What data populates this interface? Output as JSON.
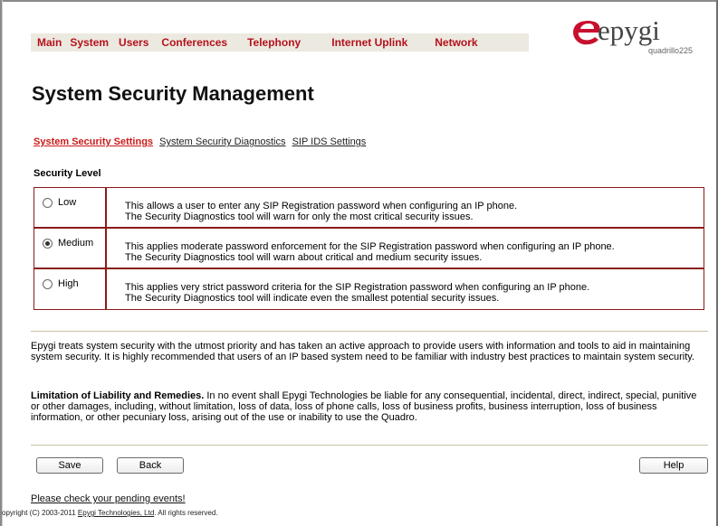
{
  "menu": [
    "Main",
    "System",
    "Users",
    "Conferences",
    "Telephony",
    "Internet Uplink",
    "Network"
  ],
  "logo": {
    "word": "epygi",
    "model": "quadrillo225",
    "color": "#c8102e"
  },
  "page_title": "System Security Management",
  "tabs": [
    "System Security Settings",
    "System Security Diagnostics",
    "SIP IDS Settings"
  ],
  "active_tab": "System Security Settings",
  "section_label": "Security Level",
  "levels": [
    {
      "label": "Low",
      "selected": false,
      "line1": "This allows a user to enter any SIP Registration password when configuring an IP phone.",
      "line2": "The Security Diagnostics tool will warn for only the most critical security issues."
    },
    {
      "label": "Medium",
      "selected": true,
      "line1": "This applies moderate password enforcement for the SIP Registration password when configuring an IP phone.",
      "line2": "The Security Diagnostics tool will warn about critical and medium security issues."
    },
    {
      "label": "High",
      "selected": false,
      "line1": "This applies very strict password criteria for the SIP Registration password when configuring an IP phone.",
      "line2": "The Security Diagnostics tool will indicate even the smallest potential security issues."
    }
  ],
  "info_text": "Epygi treats system security with the utmost priority and has taken an active approach to provide users with information and tools to aid in maintaining system security. It is highly recommended that users of an IP based system need to be familiar with industry best practices to maintain system security.",
  "liability_title": "Limitation of Liability and Remedies.",
  "liability_text": " In no event shall Epygi Technologies be liable for any consequential, incidental, direct, indirect, special, punitive or other damages, including, without limitation, loss of data, loss of phone calls, loss of business profits, business interruption, loss of business information, or other pecuniary loss, arising out of the use or inability to use the Quadro.",
  "buttons": {
    "save": "Save",
    "back": "Back",
    "help": "Help"
  },
  "pending_events": "Please check your pending events!",
  "copyright_prefix": "opyright (C) 2003-2011 ",
  "copyright_link": "Epygi Technologies, Ltd",
  "copyright_suffix": ". All rights reserved."
}
